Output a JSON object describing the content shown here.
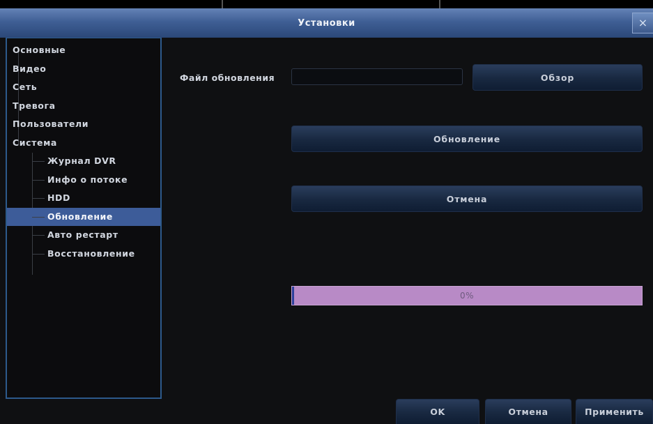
{
  "window": {
    "title": "Установки",
    "close_glyph": "×"
  },
  "sidebar": {
    "items": [
      {
        "label": "Основные",
        "level": 1
      },
      {
        "label": "Видео",
        "level": 1
      },
      {
        "label": "Сеть",
        "level": 1
      },
      {
        "label": "Тревога",
        "level": 1
      },
      {
        "label": "Пользователи",
        "level": 1
      },
      {
        "label": "Система",
        "level": 1
      },
      {
        "label": "Журнал DVR",
        "level": 2
      },
      {
        "label": "Инфо о потоке",
        "level": 2
      },
      {
        "label": "HDD",
        "level": 2
      },
      {
        "label": "Обновление",
        "level": 2,
        "selected": true
      },
      {
        "label": "Авто рестарт",
        "level": 2
      },
      {
        "label": "Восстановление",
        "level": 2
      }
    ]
  },
  "upgrade": {
    "file_label": "Файл обновления",
    "file_value": "",
    "browse_label": "Обзор",
    "update_label": "Обновление",
    "cancel_label": "Отмена",
    "progress_text": "0%",
    "progress_value": 0
  },
  "footer": {
    "ok_label": "OK",
    "cancel_label": "Отмена",
    "apply_label": "Применить"
  },
  "colors": {
    "titlebar": "#3f5f95",
    "selected": "#3d5c99",
    "progress_bg": "#b88ac6",
    "button": "#182840"
  }
}
